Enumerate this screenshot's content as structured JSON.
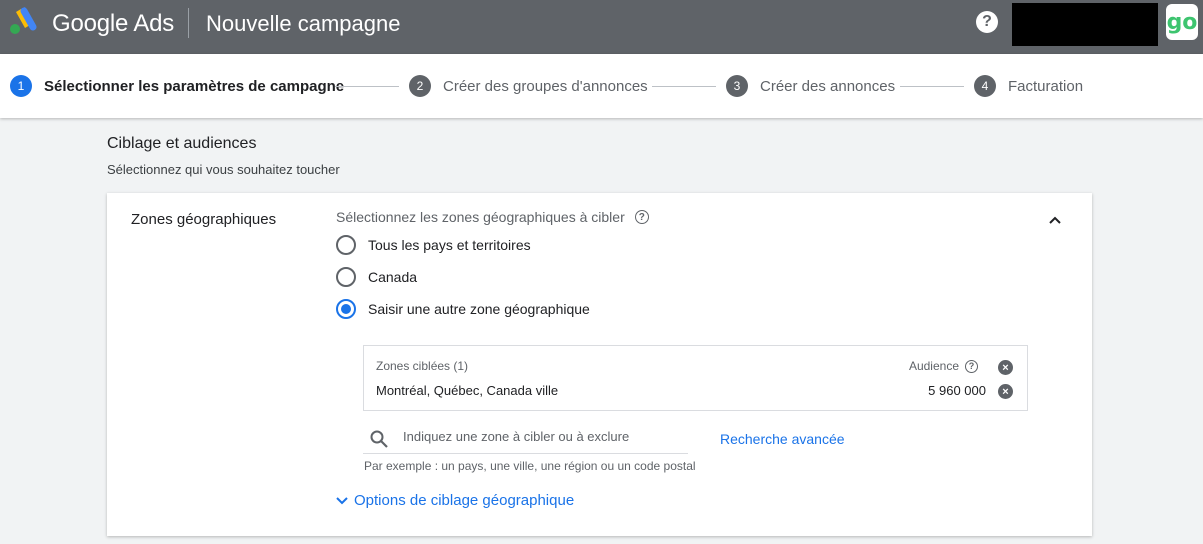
{
  "header": {
    "brand": "Google Ads",
    "title": "Nouvelle campagne",
    "help_label": "?",
    "avatar_text": "go"
  },
  "colors": {
    "header_bg": "#5f6368",
    "accent": "#1a73e8",
    "logo_blue": "#4285f4",
    "logo_yellow": "#fbbc04",
    "logo_green": "#34a853",
    "avatar_green": "#3dc46f"
  },
  "stepper": {
    "steps": [
      {
        "num": "1",
        "label": "Sélectionner les paramètres de campagne",
        "active": true
      },
      {
        "num": "2",
        "label": "Créer des groupes d'annonces",
        "active": false
      },
      {
        "num": "3",
        "label": "Créer des annonces",
        "active": false
      },
      {
        "num": "4",
        "label": "Facturation",
        "active": false
      }
    ]
  },
  "section": {
    "title": "Ciblage et audiences",
    "subtitle": "Sélectionnez qui vous souhaitez toucher"
  },
  "geo": {
    "label": "Zones géographiques",
    "prompt": "Sélectionnez les zones géographiques à cibler",
    "options": [
      {
        "label": "Tous les pays et territoires",
        "checked": false
      },
      {
        "label": "Canada",
        "checked": false
      },
      {
        "label": "Saisir une autre zone géographique",
        "checked": true
      }
    ],
    "targets_header": "Zones ciblées (1)",
    "audience_header": "Audience",
    "targets": [
      {
        "location": "Montréal, Québec, Canada ville",
        "audience": "5 960 000"
      }
    ],
    "search_placeholder": "Indiquez une zone à cibler ou à exclure",
    "advanced_search": "Recherche avancée",
    "hint": "Par exemple : un pays, une ville, une région ou un code postal",
    "options_link": "Options de ciblage géographique"
  },
  "icons": {
    "logo": "google-ads-logo-icon",
    "help": "help-icon",
    "collapse": "chevron-up-icon",
    "question": "question-circle-icon",
    "remove": "close-circle-icon",
    "search": "search-icon",
    "expand": "chevron-down-icon"
  }
}
